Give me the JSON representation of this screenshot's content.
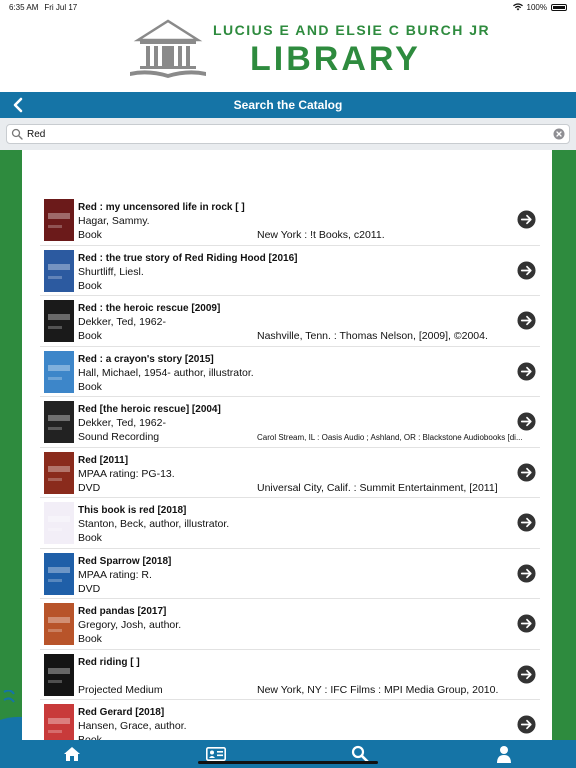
{
  "status": {
    "time": "6:35 AM",
    "date": "Fri Jul 17",
    "battery": "100%"
  },
  "header": {
    "line1": "LUCIUS E AND ELSIE C BURCH JR",
    "line2": "LIBRARY"
  },
  "titlebar": {
    "title": "Search the Catalog"
  },
  "search": {
    "value": "Red"
  },
  "results": [
    {
      "title": "Red : my uncensored life in rock [   ]",
      "author": "Hagar, Sammy.",
      "format": "Book",
      "pub": "New York : !t Books, c2011.",
      "thumb": "#6b1a1a"
    },
    {
      "title": "Red : the true story of Red Riding Hood [2016]",
      "author": "Shurtliff, Liesl.",
      "format": "Book",
      "pub": "",
      "thumb": "#2c5aa0"
    },
    {
      "title": "Red : the heroic rescue [2009]",
      "author": "Dekker, Ted, 1962-",
      "format": "Book",
      "pub": "Nashville, Tenn. : Thomas Nelson, [2009], ©2004.",
      "thumb": "#1a1a1a"
    },
    {
      "title": "Red : a crayon's story [2015]",
      "author": "Hall, Michael, 1954- author, illustrator.",
      "format": "Book",
      "pub": "",
      "thumb": "#3d86c9"
    },
    {
      "title": "Red [the heroic rescue] [2004]",
      "author": "Dekker, Ted, 1962-",
      "format": "Sound Recording",
      "pub": "Carol Stream, IL : Oasis Audio ; Ashland, OR : Blackstone Audiobooks [di...",
      "thumb": "#222222"
    },
    {
      "title": "Red [2011]",
      "author": "MPAA rating: PG-13.",
      "format": "DVD",
      "pub": "Universal City, Calif. : Summit Entertainment, [2011]",
      "thumb": "#8a2b1c"
    },
    {
      "title": "This book is red [2018]",
      "author": "Stanton, Beck, author, illustrator.",
      "format": "Book",
      "pub": "",
      "thumb": "#f2eef7"
    },
    {
      "title": "Red Sparrow [2018]",
      "author": "MPAA rating: R.",
      "format": "DVD",
      "pub": "",
      "thumb": "#1f5fa8"
    },
    {
      "title": "Red pandas [2017]",
      "author": "Gregory, Josh, author.",
      "format": "Book",
      "pub": "",
      "thumb": "#b8542a"
    },
    {
      "title": "Red riding [   ]",
      "author": "",
      "format": "Projected Medium",
      "pub": "New York, NY : IFC Films : MPI Media Group, 2010.",
      "thumb": "#141414"
    },
    {
      "title": "Red Gerard [2018]",
      "author": "Hansen, Grace, author.",
      "format": "Book",
      "pub": "",
      "thumb": "#c83a3a"
    }
  ],
  "colors": {
    "brand_green": "#2e8b3e",
    "nav_blue": "#1574a6",
    "arrow": "#333333"
  },
  "icons": {
    "back": "chevron-left-icon",
    "go": "arrow-right-circle-icon",
    "home": "home-icon",
    "card": "library-card-icon",
    "search": "search-icon",
    "account": "person-icon"
  }
}
